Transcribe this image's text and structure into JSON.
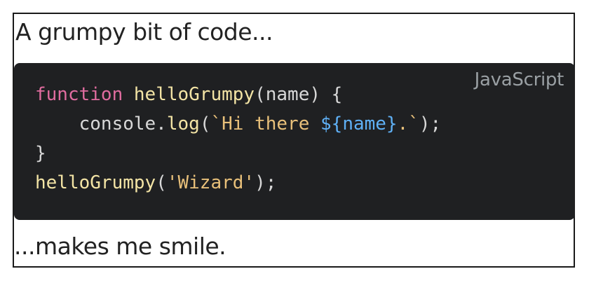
{
  "heading": "A grumpy bit of code...",
  "code_block": {
    "language": "JavaScript",
    "lines": [
      [
        {
          "text": "function",
          "kind": "keyword"
        },
        {
          "text": " ",
          "kind": "plain"
        },
        {
          "text": "helloGrumpy",
          "kind": "function"
        },
        {
          "text": "(name) {",
          "kind": "plain"
        }
      ],
      [
        {
          "text": "    console.",
          "kind": "plain"
        },
        {
          "text": "log",
          "kind": "function"
        },
        {
          "text": "(",
          "kind": "plain"
        },
        {
          "text": "`Hi there ",
          "kind": "string"
        },
        {
          "text": "${name}",
          "kind": "interpolation"
        },
        {
          "text": ".`",
          "kind": "string"
        },
        {
          "text": ");",
          "kind": "plain"
        }
      ],
      [
        {
          "text": "}",
          "kind": "plain"
        }
      ],
      [
        {
          "text": "helloGrumpy",
          "kind": "function"
        },
        {
          "text": "(",
          "kind": "plain"
        },
        {
          "text": "'Wizard'",
          "kind": "string"
        },
        {
          "text": ");",
          "kind": "plain"
        }
      ]
    ]
  },
  "footer": "...makes me smile.",
  "colors": {
    "code_background": "#1f2022",
    "keyword": "#e06c9f",
    "function": "#f3e4a5",
    "string": "#e8c07a",
    "interpolation": "#5fb0f5",
    "plain": "#d8d8d8",
    "language_label": "#9aa0a4"
  }
}
